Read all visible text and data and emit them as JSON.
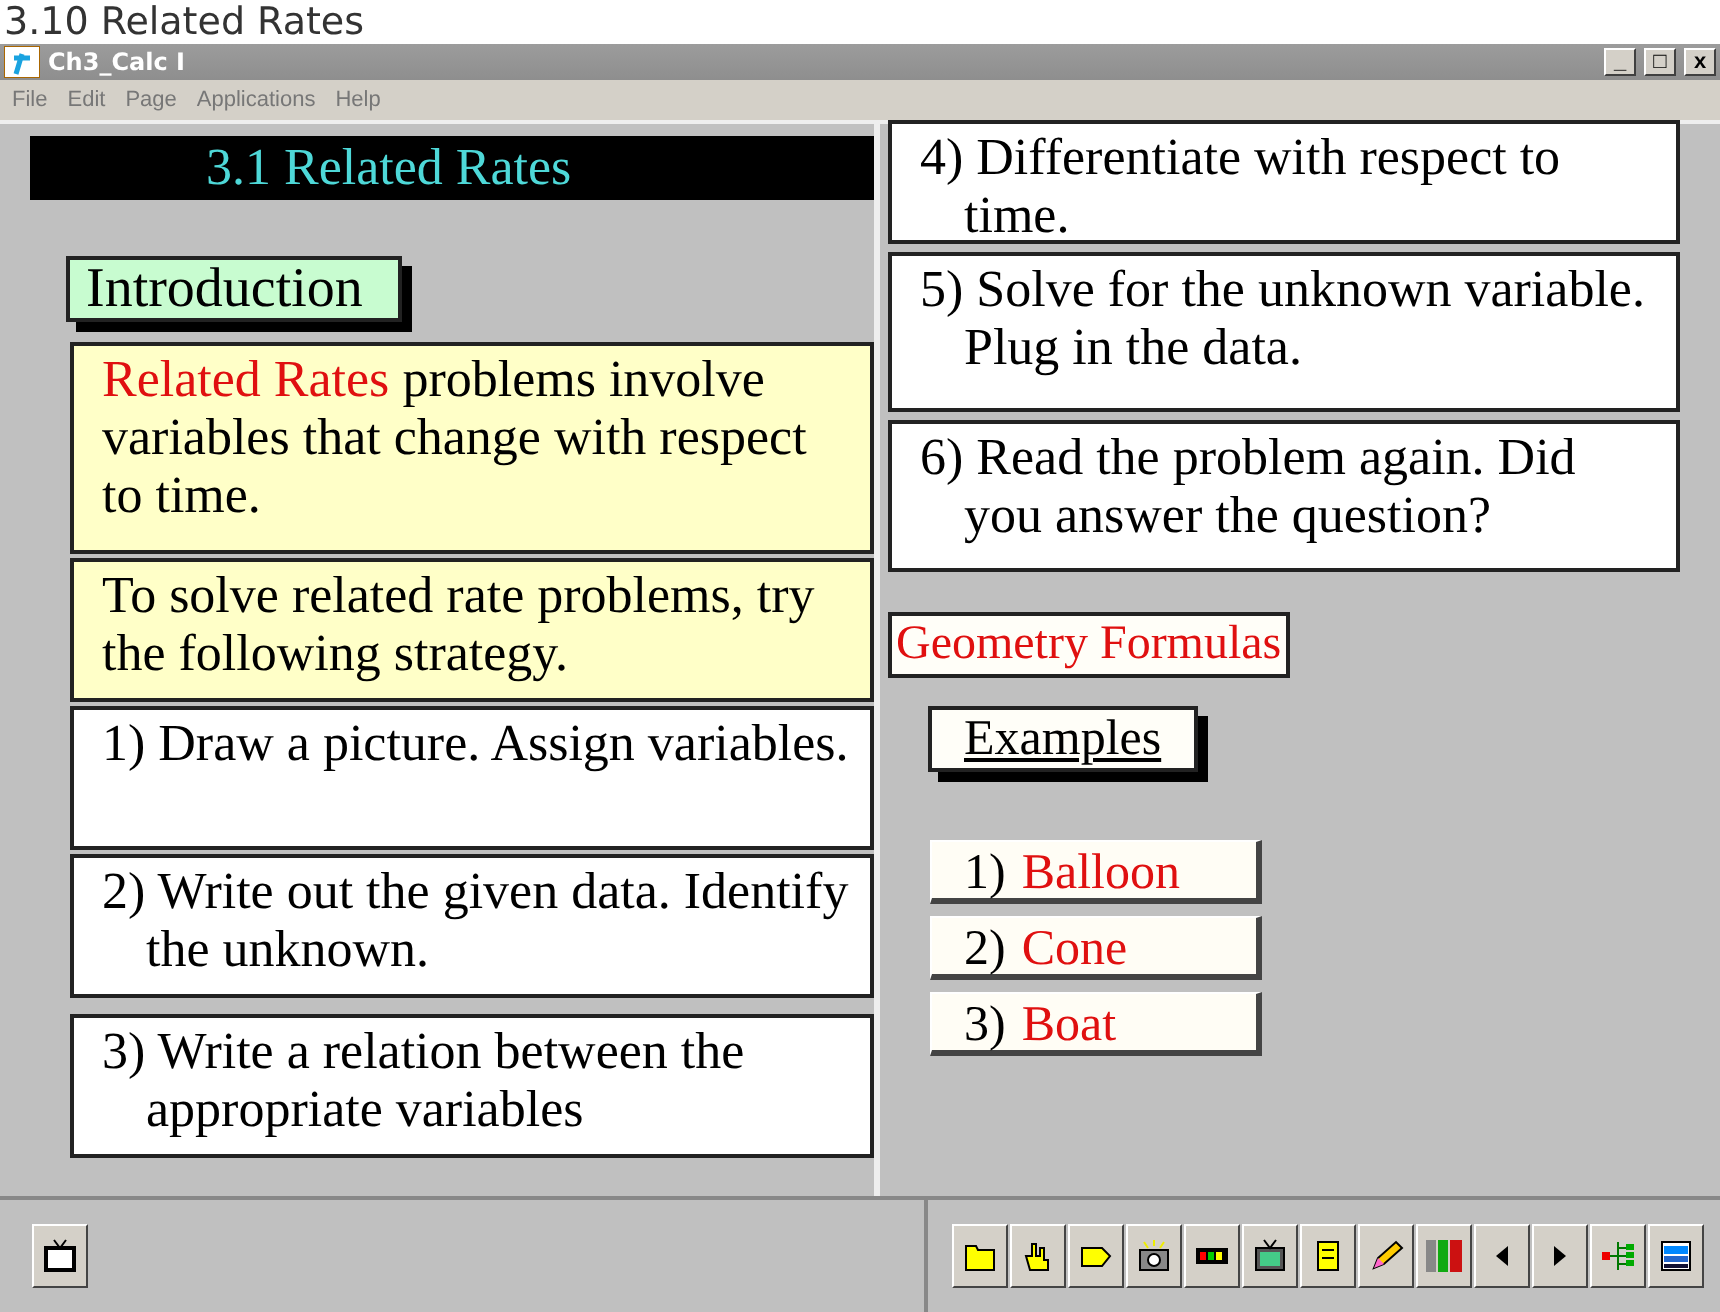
{
  "page_heading": "3.10 Related Rates",
  "window": {
    "title": "Ch3_Calc I",
    "controls": [
      "_",
      "□",
      "x"
    ]
  },
  "menu": [
    "File",
    "Edit",
    "Page",
    "Applications",
    "Help"
  ],
  "left_pane": {
    "banner": "3.1  Related Rates",
    "intro_button": "Introduction",
    "intro": {
      "highlight": "Related Rates",
      "text": " problems involve variables that change with respect to time."
    },
    "strategy_intro": "To solve related rate problems, try the following strategy.",
    "steps": [
      "1) Draw a picture. Assign variables.",
      "2) Write out the given data. Identify the unknown.",
      "3) Write a relation between the appropriate variables"
    ]
  },
  "right_pane": {
    "steps": [
      "4) Differentiate with respect to time.",
      "5) Solve for the unknown variable. Plug in the data.",
      "6) Read the problem again. Did you answer the question?"
    ],
    "formulas_link": "Geometry Formulas",
    "examples_button": "Examples",
    "examples": [
      {
        "number": "1)",
        "label": "Balloon"
      },
      {
        "number": "2)",
        "label": "Cone"
      },
      {
        "number": "3)",
        "label": "Boat"
      }
    ]
  }
}
